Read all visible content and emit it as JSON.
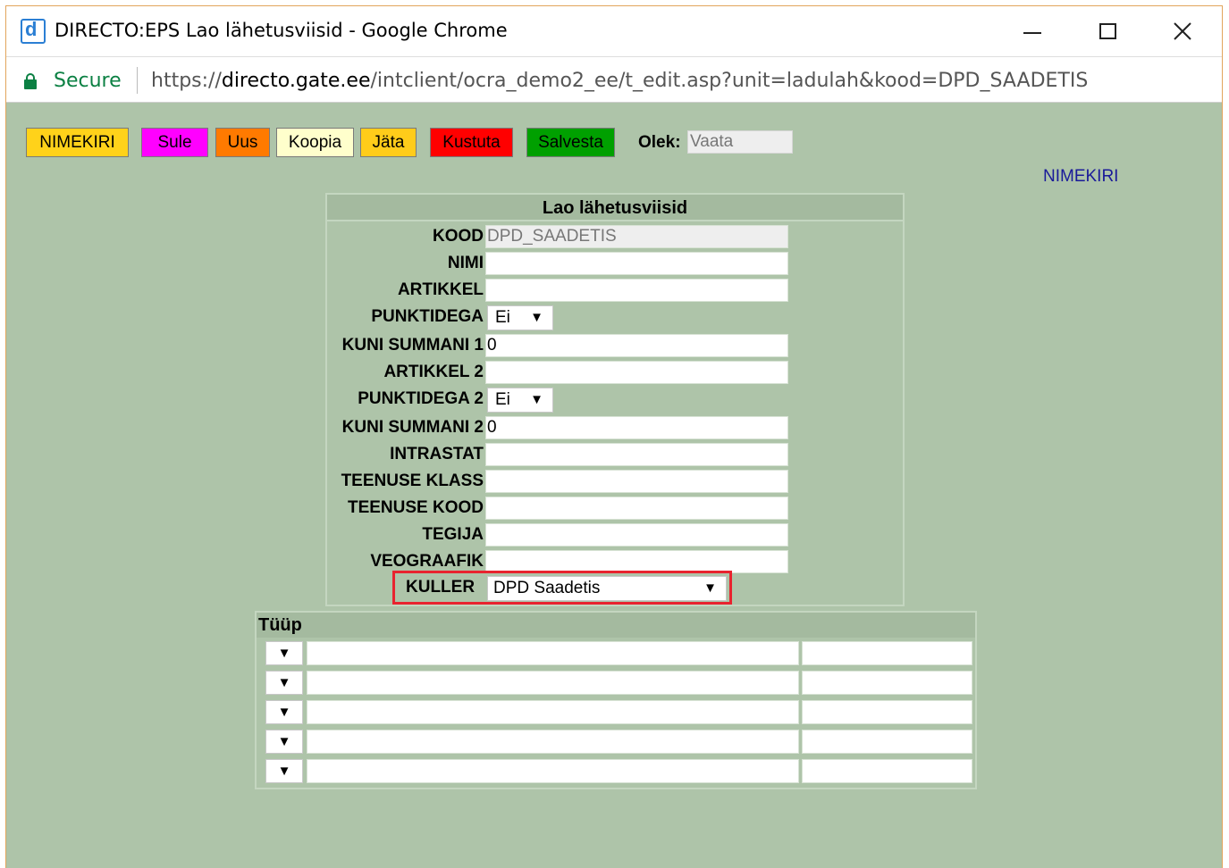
{
  "window": {
    "title": "DIRECTO:EPS Lao lähetusviisid - Google Chrome",
    "app_icon_letter": "d"
  },
  "address_bar": {
    "secure_label": "Secure",
    "url_scheme": "https://",
    "url_host": "directo.gate.ee",
    "url_path": "/intclient/ocra_demo2_ee/t_edit.asp?unit=ladulah&kood=DPD_SAADETIS"
  },
  "toolbar": {
    "buttons": [
      {
        "label": "NIMEKIRI",
        "color": "#ffd21a"
      },
      {
        "label": "Sule",
        "color": "#ff00ff"
      },
      {
        "label": "Uus",
        "color": "#ff7a00"
      },
      {
        "label": "Koopia",
        "color": "#ffffcc"
      },
      {
        "label": "Jäta",
        "color": "#ffcc1a"
      },
      {
        "label": "Kustuta",
        "color": "#ff0000"
      },
      {
        "label": "Salvesta",
        "color": "#00a000"
      }
    ],
    "state_label": "Olek:",
    "state_value": "Vaata",
    "list_link": "NIMEKIRI"
  },
  "form": {
    "title": "Lao lähetusviisid",
    "fields": [
      {
        "label": "KOOD",
        "value": "DPD_SAADETIS"
      },
      {
        "label": "NIMI",
        "value": ""
      },
      {
        "label": "ARTIKKEL",
        "value": ""
      },
      {
        "label": "PUNKTIDEGA",
        "value": "Ei"
      },
      {
        "label": "KUNI SUMMANI 1",
        "value": "0"
      },
      {
        "label": "ARTIKKEL 2",
        "value": ""
      },
      {
        "label": "PUNKTIDEGA 2",
        "value": "Ei"
      },
      {
        "label": "KUNI SUMMANI 2",
        "value": "0"
      },
      {
        "label": "INTRASTAT",
        "value": ""
      },
      {
        "label": "TEENUSE KLASS",
        "value": ""
      },
      {
        "label": "TEENUSE KOOD",
        "value": ""
      },
      {
        "label": "TEGIJA",
        "value": ""
      },
      {
        "label": "VEOGRAAFIK",
        "value": ""
      }
    ],
    "kuller": {
      "label": "KULLER",
      "value": "DPD Saadetis",
      "highlight_color": "#e8242f"
    }
  },
  "type_table": {
    "header": "Tüüp",
    "row_count": 5
  },
  "icons": {
    "dropdown_arrow": "▼"
  }
}
